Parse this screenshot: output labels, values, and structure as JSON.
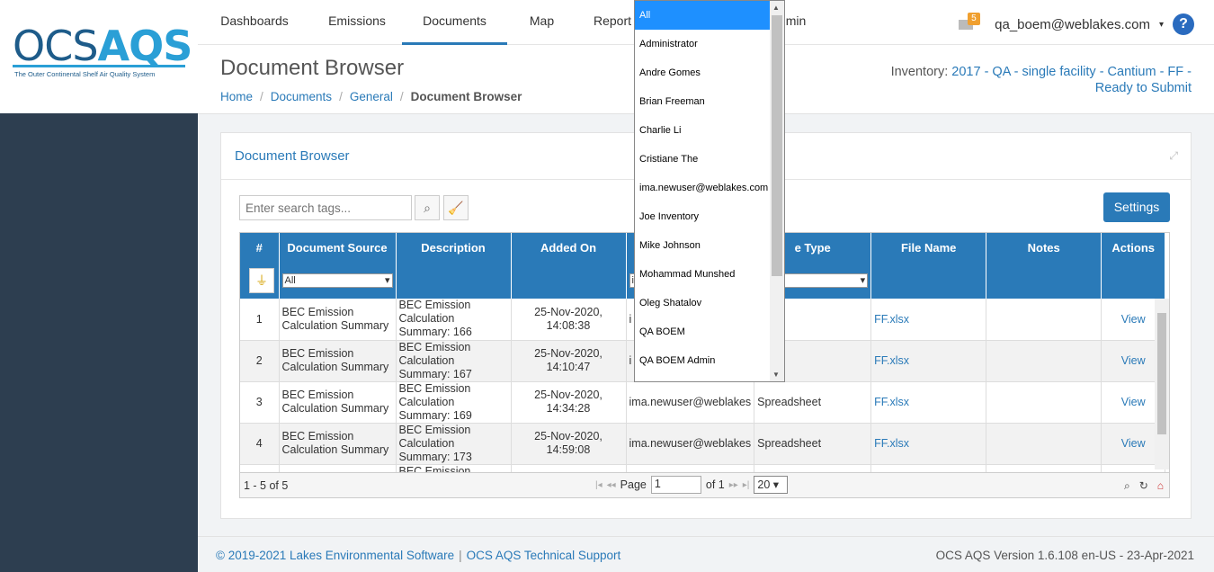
{
  "logo": {
    "ocs": "OCS",
    "aqs": "AQS",
    "tagline": "The Outer Continental Shelf Air Quality System"
  },
  "nav": [
    {
      "label": "Dashboards",
      "active": false
    },
    {
      "label": "Emissions",
      "active": false
    },
    {
      "label": "Documents",
      "active": true
    },
    {
      "label": "Map",
      "active": false
    },
    {
      "label": "Report",
      "active": false
    },
    {
      "label": "min",
      "active": false
    }
  ],
  "user": {
    "mail_count": "5",
    "name": "qa_boem@weblakes.com",
    "caret": "▾",
    "help": "?"
  },
  "page": {
    "title": "Document Browser"
  },
  "breadcrumb": {
    "home": "Home",
    "documents": "Documents",
    "general": "General",
    "current": "Document Browser",
    "sep": "/"
  },
  "inventory": {
    "label": "Inventory: ",
    "value": "2017 - QA - single facility - Cantium - FF - Ready to Submit"
  },
  "panel": {
    "title": "Document Browser"
  },
  "toolbar": {
    "search_placeholder": "Enter search tags...",
    "settings_label": "Settings"
  },
  "grid": {
    "headers": [
      "#",
      "Document Source",
      "Description",
      "Added On",
      "",
      "e Type",
      "File Name",
      "Notes",
      "Actions"
    ],
    "filters": {
      "source": "All",
      "added_by": "i",
      "type": ""
    },
    "rows": [
      {
        "num": "1",
        "source": "BEC Emission Calculation Summary",
        "description": "BEC Emission Calculation Summary: 166",
        "added_on": "25-Nov-2020, 14:08:38",
        "added_by": "i",
        "type": "sheet",
        "file": "FF.xlsx",
        "notes": "",
        "action": "View"
      },
      {
        "num": "2",
        "source": "BEC Emission Calculation Summary",
        "description": "BEC Emission Calculation Summary: 167",
        "added_on": "25-Nov-2020, 14:10:47",
        "added_by": "i",
        "type": "sheet",
        "file": "FF.xlsx",
        "notes": "",
        "action": "View"
      },
      {
        "num": "3",
        "source": "BEC Emission Calculation Summary",
        "description": "BEC Emission Calculation Summary: 169",
        "added_on": "25-Nov-2020, 14:34:28",
        "added_by": "ima.newuser@weblakes",
        "type": "Spreadsheet",
        "file": "FF.xlsx",
        "notes": "",
        "action": "View"
      },
      {
        "num": "4",
        "source": "BEC Emission Calculation Summary",
        "description": "BEC Emission Calculation Summary: 173",
        "added_on": "25-Nov-2020, 14:59:08",
        "added_by": "ima.newuser@weblakes",
        "type": "Spreadsheet",
        "file": "FF.xlsx",
        "notes": "",
        "action": "View"
      },
      {
        "num": "",
        "source": "",
        "description": "BEC Emission",
        "added_on": "",
        "added_by": "",
        "type": "",
        "file": "",
        "notes": "",
        "action": ""
      }
    ]
  },
  "pager": {
    "count": "1 - 5 of 5",
    "page_label": "Page",
    "page_value": "1",
    "of_label": "of 1",
    "page_size": "20"
  },
  "dropdown": {
    "options": [
      "All",
      "Administrator",
      "Andre Gomes",
      "Brian Freeman",
      "Charlie Li",
      "Cristiane The",
      "ima.newuser@weblakes.com",
      "Joe Inventory",
      "Mike Johnson",
      "Mohammad Munshed",
      "Oleg Shatalov",
      "QA BOEM",
      "QA BOEM Admin"
    ],
    "selected": "All"
  },
  "footer": {
    "copyright": "© 2019-2021 Lakes Environmental Software",
    "support": "OCS AQS Technical Support",
    "version": "OCS AQS Version 1.6.108 en-US - 23-Apr-2021"
  },
  "colors": {
    "accent": "#2a7ab8",
    "sidebar": "#2d3e50",
    "badge": "#f0a030"
  },
  "icons": [
    "mail-icon",
    "help-icon",
    "search-icon",
    "clear-filter-icon",
    "expand-icon",
    "filter-clear-icon",
    "zoom-icon",
    "refresh-icon",
    "export-icon"
  ]
}
